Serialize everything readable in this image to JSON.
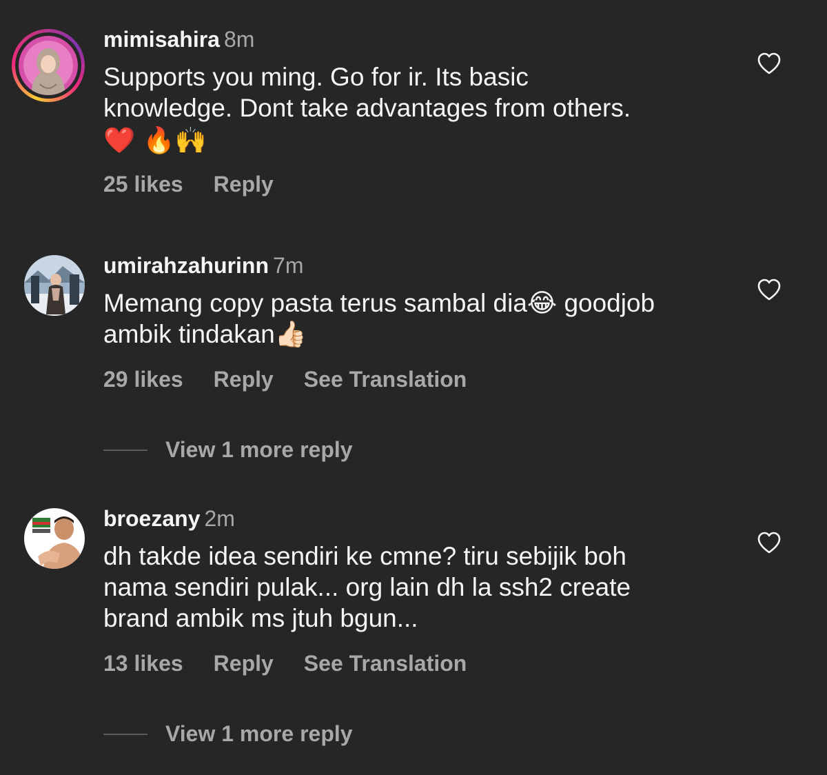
{
  "comments": [
    {
      "username": "mimisahira",
      "time": "8m",
      "text_lines": [
        "Supports you ming. Go for ir. Its basic",
        "knowledge. Dont take advantages from others."
      ],
      "emoji_line": "❤️ 🔥🙌",
      "likes": "25 likes",
      "reply": "Reply",
      "has_story_ring": true
    },
    {
      "username": "umirahzahurinn",
      "time": "7m",
      "text_lines": [
        "Memang copy pasta terus sambal dia😂 goodjob",
        "ambik tindakan👍🏻"
      ],
      "likes": "29 likes",
      "reply": "Reply",
      "translation": "See Translation",
      "view_more": "View 1 more reply"
    },
    {
      "username": "broezany",
      "time": "2m",
      "text_lines": [
        "dh takde idea sendiri ke cmne? tiru sebijik boh",
        "nama sendiri pulak... org lain dh la ssh2 create",
        "brand ambik ms jtuh bgun..."
      ],
      "likes": "13 likes",
      "reply": "Reply",
      "translation": "See Translation",
      "view_more": "View 1 more reply"
    }
  ],
  "icons": {
    "like": "heart-outline-icon"
  },
  "colors": {
    "background": "#262626",
    "primary_text": "#f5f5f5",
    "secondary_text": "#a8a8a8"
  }
}
